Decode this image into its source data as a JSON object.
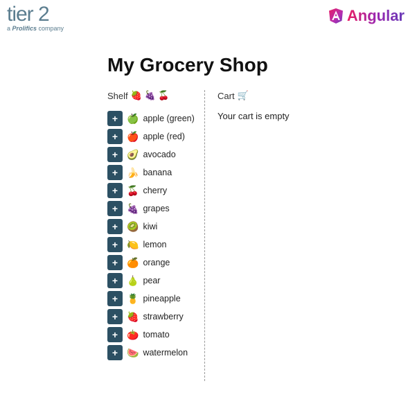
{
  "header": {
    "tier2_main": "tier 2",
    "tier2_sub_prefix": "a ",
    "tier2_sub_brand": "Prolifics",
    "tier2_sub_suffix": " company",
    "angular_label": "Angular"
  },
  "page_title": "My Grocery Shop",
  "shelf": {
    "label": "Shelf",
    "emojis": "🍓 🍇 🍒",
    "add_button_label": "+",
    "items": [
      {
        "emoji": "🍏",
        "name": "apple (green)"
      },
      {
        "emoji": "🍎",
        "name": "apple (red)"
      },
      {
        "emoji": "🥑",
        "name": "avocado"
      },
      {
        "emoji": "🍌",
        "name": "banana"
      },
      {
        "emoji": "🍒",
        "name": "cherry"
      },
      {
        "emoji": "🍇",
        "name": "grapes"
      },
      {
        "emoji": "🥝",
        "name": "kiwi"
      },
      {
        "emoji": "🍋",
        "name": "lemon"
      },
      {
        "emoji": "🍊",
        "name": "orange"
      },
      {
        "emoji": "🍐",
        "name": "pear"
      },
      {
        "emoji": "🍍",
        "name": "pineapple"
      },
      {
        "emoji": "🍓",
        "name": "strawberry"
      },
      {
        "emoji": "🍅",
        "name": "tomato"
      },
      {
        "emoji": "🍉",
        "name": "watermelon"
      }
    ]
  },
  "cart": {
    "label": "Cart",
    "emoji": "🛒",
    "empty_message": "Your cart is empty"
  }
}
